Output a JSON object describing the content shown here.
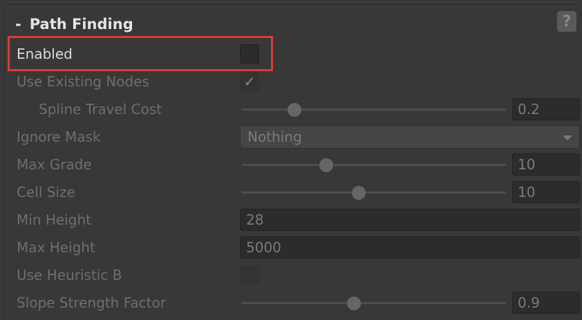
{
  "header": {
    "collapse_symbol": "-",
    "title": "Path Finding",
    "help_symbol": "?"
  },
  "fields": {
    "enabled": {
      "label": "Enabled",
      "checked": false
    },
    "use_existing_nodes": {
      "label": "Use Existing Nodes",
      "checked": true,
      "check_glyph": "✓"
    },
    "spline_travel_cost": {
      "label": "Spline Travel Cost",
      "value": "0.2",
      "slider_fraction": 0.2
    },
    "ignore_mask": {
      "label": "Ignore Mask",
      "value": "Nothing"
    },
    "max_grade": {
      "label": "Max Grade",
      "value": "10",
      "slider_fraction": 0.32
    },
    "cell_size": {
      "label": "Cell Size",
      "value": "10",
      "slider_fraction": 0.445
    },
    "min_height": {
      "label": "Min Height",
      "value": "28"
    },
    "max_height": {
      "label": "Max Height",
      "value": "5000"
    },
    "use_heuristic_b": {
      "label": "Use Heuristic B",
      "checked": false
    },
    "slope_strength_factor": {
      "label": "Slope Strength Factor",
      "value": "0.9",
      "slider_fraction": 0.425
    }
  },
  "icons": {
    "dropdown_arrow": "chevron-down-icon",
    "help": "help-icon"
  },
  "colors": {
    "highlight": "#e03a3a",
    "background": "#383838"
  }
}
